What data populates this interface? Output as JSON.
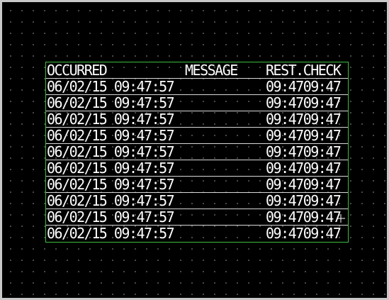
{
  "table": {
    "headers": {
      "occurred": "OCCURRED",
      "message": "MESSAGE",
      "rest_check": "REST.CHECK"
    },
    "rows": [
      {
        "occurred": "06/02/15 09:47:57",
        "message": "",
        "rest_check": "09:4709:47"
      },
      {
        "occurred": "06/02/15 09:47:57",
        "message": "",
        "rest_check": "09:4709:47"
      },
      {
        "occurred": "06/02/15 09:47:57",
        "message": "",
        "rest_check": "09:4709:47"
      },
      {
        "occurred": "06/02/15 09:47:57",
        "message": "",
        "rest_check": "09:4709:47"
      },
      {
        "occurred": "06/02/15 09:47:57",
        "message": "",
        "rest_check": "09:4709:47"
      },
      {
        "occurred": "06/02/15 09:47:57",
        "message": "",
        "rest_check": "09:4709:47"
      },
      {
        "occurred": "06/02/15 09:47:57",
        "message": "",
        "rest_check": "09:4709:47"
      },
      {
        "occurred": "06/02/15 09:47:57",
        "message": "",
        "rest_check": "09:4709:47"
      },
      {
        "occurred": "06/02/15 09:47:57",
        "message": "",
        "rest_check": "09:4709:47"
      },
      {
        "occurred": "06/02/15 09:47:57",
        "message": "",
        "rest_check": "09:4709:47"
      }
    ]
  },
  "colors": {
    "background": "#000000",
    "grid_dot": "#5a5a5a",
    "frame": "#3cbf3c",
    "text": "#ffffff",
    "row_line": "#d8d8d8"
  }
}
